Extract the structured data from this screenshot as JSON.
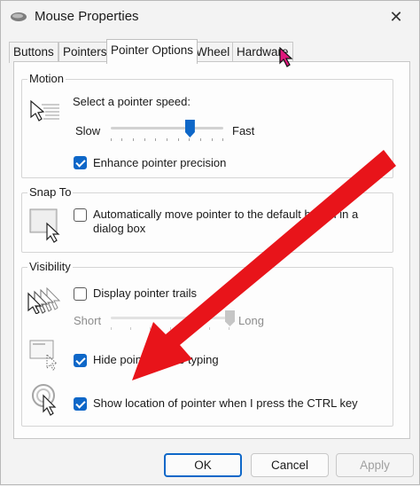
{
  "window": {
    "title": "Mouse Properties",
    "close_glyph": "✕"
  },
  "tabs": [
    {
      "label": "Buttons",
      "active": false
    },
    {
      "label": "Pointers",
      "active": false
    },
    {
      "label": "Pointer Options",
      "active": true
    },
    {
      "label": "Wheel",
      "active": false
    },
    {
      "label": "Hardware",
      "active": false
    }
  ],
  "motion": {
    "title": "Motion",
    "speed_label": "Select a pointer speed:",
    "slow_label": "Slow",
    "fast_label": "Fast",
    "speed_fraction": 0.7,
    "precision_label": "Enhance pointer precision",
    "precision_checked": true
  },
  "snap_to": {
    "title": "Snap To",
    "snap_label_line1": "Automatically move pointer to the default button in a",
    "snap_label_line2": "dialog box",
    "snap_checked": false
  },
  "visibility": {
    "title": "Visibility",
    "trails_label": "Display pointer trails",
    "trails_checked": false,
    "short_label": "Short",
    "long_label": "Long",
    "trails_fraction": 1.0,
    "hide_label": "Hide pointer while typing",
    "hide_checked": true,
    "show_location_label": "Show location of pointer when I press the CTRL key",
    "show_location_checked": true
  },
  "buttons": {
    "ok": "OK",
    "cancel": "Cancel",
    "apply": "Apply"
  },
  "colors": {
    "accent": "#0e67c8",
    "annotation_arrow": "#e8141a",
    "cursor_pink": "#e0197d"
  },
  "icons": [
    "mouse-icon",
    "close-icon",
    "pointer-speed-icon",
    "snap-to-icon",
    "pointer-trails-icon",
    "hide-pointer-icon",
    "show-location-icon",
    "arrow-cursor-icon"
  ]
}
